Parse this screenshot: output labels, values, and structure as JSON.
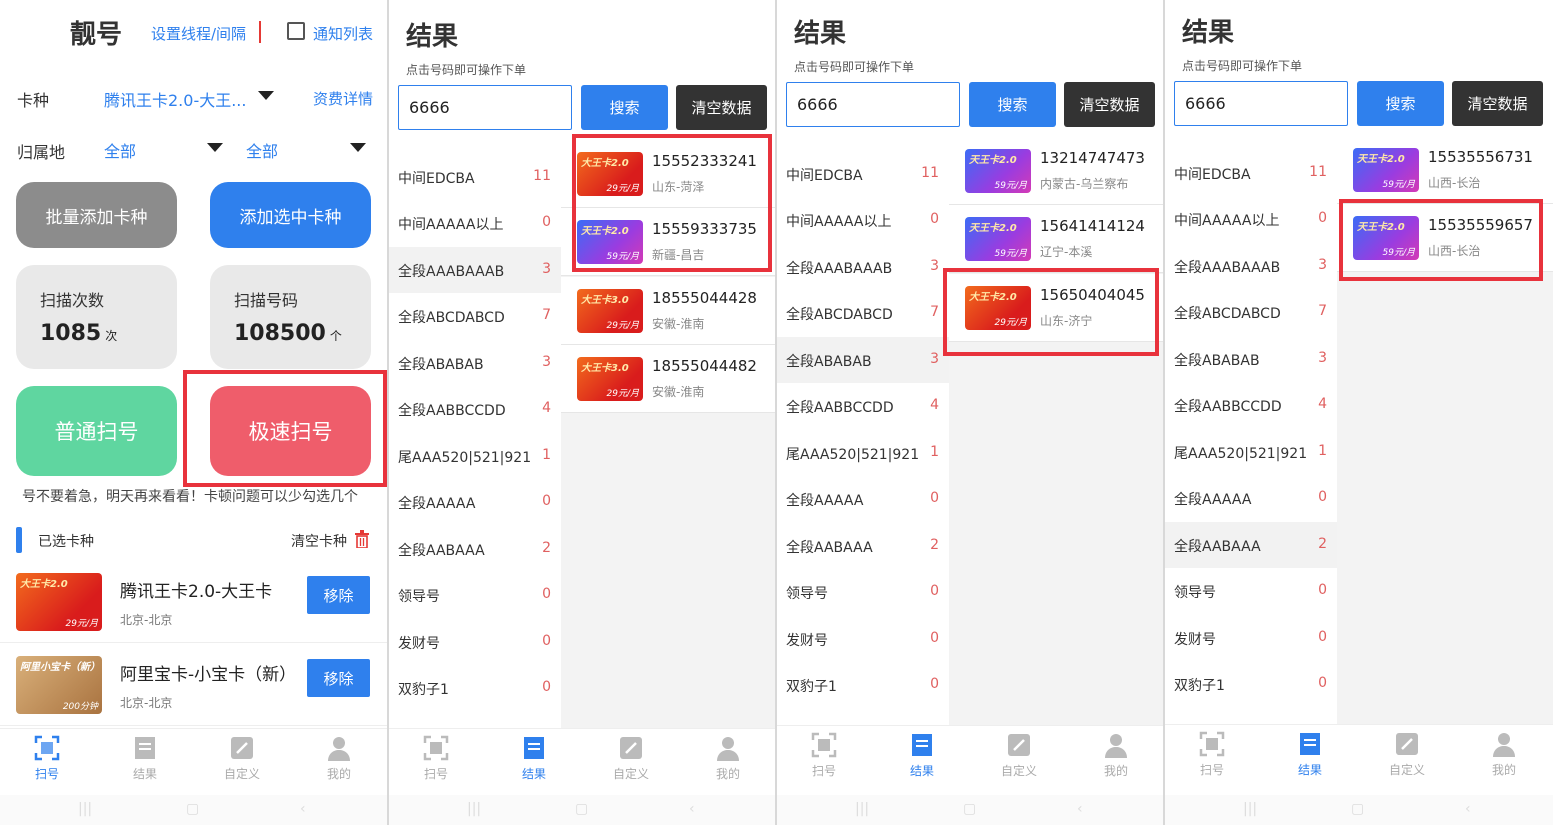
{
  "scan": {
    "title": "靓号",
    "settings_link": "设置线程/间隔",
    "notify_label": "通知列表",
    "card_type_label": "卡种",
    "card_type_value": "腾讯王卡2.0-大王...",
    "fee_link": "资费详情",
    "region_label": "归属地",
    "region_province": "全部",
    "region_city": "全部",
    "batch_add": "批量添加卡种",
    "add_selected": "添加选中卡种",
    "scan_count_label": "扫描次数",
    "scan_count_value": "1085",
    "scan_count_unit": "次",
    "scan_numbers_label": "扫描号码",
    "scan_numbers_value": "108500",
    "scan_numbers_unit": "个",
    "normal_scan": "普通扫号",
    "fast_scan": "极速扫号",
    "marquee": "号不要着急，明天再来看看！卡顿问题可以少勾选几个",
    "selected_label": "已选卡种",
    "clear_cards": "清空卡种",
    "remove_label": "移除",
    "cards": [
      {
        "name": "腾讯王卡2.0-大王卡",
        "location": "北京-北京",
        "thumb_title": "大王卡2.0",
        "thumb_price": "29元/月",
        "style": "red"
      },
      {
        "name": "阿里宝卡-小宝卡（新）",
        "location": "北京-北京",
        "thumb_title": "阿里小宝卡（新）",
        "thumb_price": "200分钟",
        "style": "gold"
      }
    ]
  },
  "tabs": [
    "扫号",
    "结果",
    "自定义",
    "我的"
  ],
  "results_common": {
    "title": "结果",
    "hint": "点击号码即可操作下单",
    "search_value": "6666",
    "search_btn": "搜索",
    "clear_btn": "清空数据",
    "categories": [
      {
        "name": "中间EDCBA",
        "count": "11"
      },
      {
        "name": "中间AAAAA以上",
        "count": "0"
      },
      {
        "name": "全段AAABAAAB",
        "count": "3"
      },
      {
        "name": "全段ABCDABCD",
        "count": "7"
      },
      {
        "name": "全段ABABAB",
        "count": "3"
      },
      {
        "name": "全段AABBCCDD",
        "count": "4"
      },
      {
        "name": "尾AAA520|521|921",
        "count": "1"
      },
      {
        "name": "全段AAAAA",
        "count": "0"
      },
      {
        "name": "全段AABAAA",
        "count": "2"
      },
      {
        "name": "领导号",
        "count": "0"
      },
      {
        "name": "发财号",
        "count": "0"
      },
      {
        "name": "双豹子1",
        "count": "0"
      }
    ]
  },
  "results": [
    {
      "items": [
        {
          "number": "15552333241",
          "location": "山东-菏泽",
          "thumb_title": "大王卡2.0",
          "thumb_price": "29元/月",
          "style": "red"
        },
        {
          "number": "15559333735",
          "location": "新疆-昌吉",
          "thumb_title": "天王卡2.0",
          "thumb_price": "59元/月",
          "style": "purple"
        },
        {
          "number": "18555044428",
          "location": "安徽-淮南",
          "thumb_title": "大王卡3.0",
          "thumb_price": "29元/月",
          "style": "red"
        },
        {
          "number": "18555044482",
          "location": "安徽-淮南",
          "thumb_title": "大王卡3.0",
          "thumb_price": "29元/月",
          "style": "red"
        }
      ]
    },
    {
      "items": [
        {
          "number": "13214747473",
          "location": "内蒙古-乌兰察布",
          "thumb_title": "天王卡2.0",
          "thumb_price": "59元/月",
          "style": "purple"
        },
        {
          "number": "15641414124",
          "location": "辽宁-本溪",
          "thumb_title": "天王卡2.0",
          "thumb_price": "59元/月",
          "style": "purple"
        },
        {
          "number": "15650404045",
          "location": "山东-济宁",
          "thumb_title": "大王卡2.0",
          "thumb_price": "29元/月",
          "style": "red"
        }
      ]
    },
    {
      "items": [
        {
          "number": "15535556731",
          "location": "山西-长治",
          "thumb_title": "天王卡2.0",
          "thumb_price": "59元/月",
          "style": "purple"
        },
        {
          "number": "15535559657",
          "location": "山西-长治",
          "thumb_title": "天王卡2.0",
          "thumb_price": "59元/月",
          "style": "purple"
        }
      ]
    }
  ],
  "colors": {
    "accent": "#2f80ed",
    "highlight_box": "#e8323c",
    "normal_scan": "#5fd6a0",
    "fast_scan": "#ef5d6b"
  }
}
